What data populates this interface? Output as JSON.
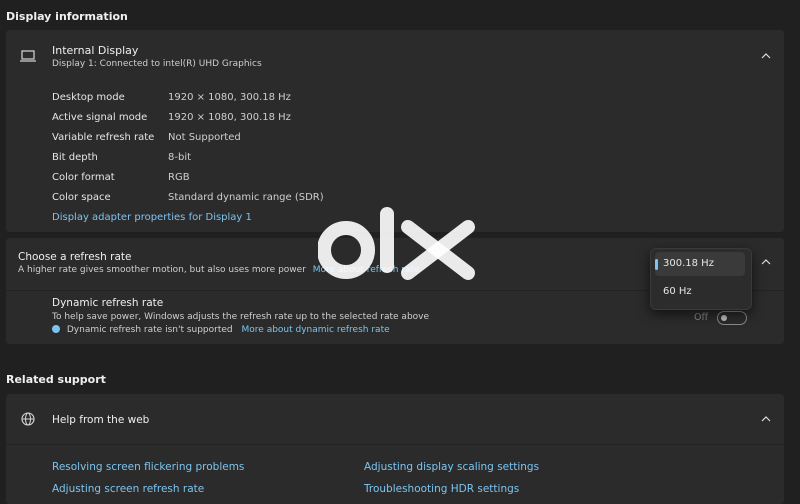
{
  "display_info": {
    "title": "Display information",
    "display": {
      "name": "Internal Display",
      "subtitle": "Display 1: Connected to intel(R) UHD Graphics",
      "icon": "laptop-icon"
    },
    "rows": [
      {
        "label": "Desktop mode",
        "value": "1920 × 1080, 300.18 Hz"
      },
      {
        "label": "Active signal mode",
        "value": "1920 × 1080, 300.18 Hz"
      },
      {
        "label": "Variable refresh rate",
        "value": "Not Supported"
      },
      {
        "label": "Bit depth",
        "value": "8-bit"
      },
      {
        "label": "Color format",
        "value": "RGB"
      },
      {
        "label": "Color space",
        "value": "Standard dynamic range (SDR)"
      }
    ],
    "adapter_link": "Display adapter properties for Display 1"
  },
  "refresh": {
    "title": "Choose a refresh rate",
    "subtitle": "A higher rate gives smoother motion, but also uses more power",
    "more_link": "More about refresh rate",
    "options": [
      "300.18 Hz",
      "60 Hz"
    ],
    "selected": "300.18 Hz",
    "dynamic": {
      "title": "Dynamic refresh rate",
      "subtitle": "To help save power, Windows adjusts the refresh rate up to the selected rate above",
      "info": "Dynamic refresh rate isn't supported",
      "more_link": "More about dynamic refresh rate",
      "toggle_state": "Off"
    }
  },
  "related": {
    "title": "Related support",
    "help": {
      "label": "Help from the web",
      "icon": "globe-icon"
    },
    "links": [
      "Resolving screen flickering problems",
      "Adjusting display scaling settings",
      "Adjusting screen refresh rate",
      "Troubleshooting HDR settings"
    ]
  },
  "watermark": "olx",
  "colors": {
    "background": "#202020",
    "card": "#2b2b2b",
    "accent": "#7cc4f0"
  }
}
